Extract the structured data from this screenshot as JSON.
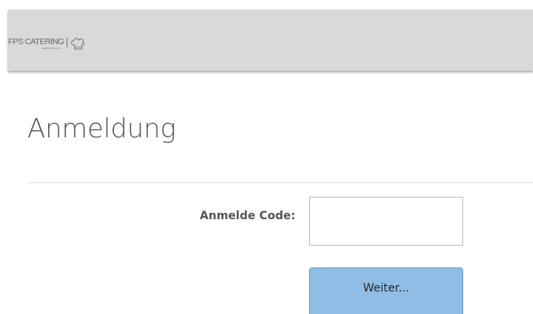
{
  "header": {
    "logo_text": "FPS CATERING",
    "logo_tagline": "quality delivered",
    "logo_icon": "chef-hat-icon",
    "background": "#d9d9d9"
  },
  "page": {
    "title": "Anmeldung"
  },
  "form": {
    "code_label": "Anmelde Code:",
    "code_value": "",
    "submit_label": "Weiter...",
    "submit_color": "#8fbde6"
  }
}
